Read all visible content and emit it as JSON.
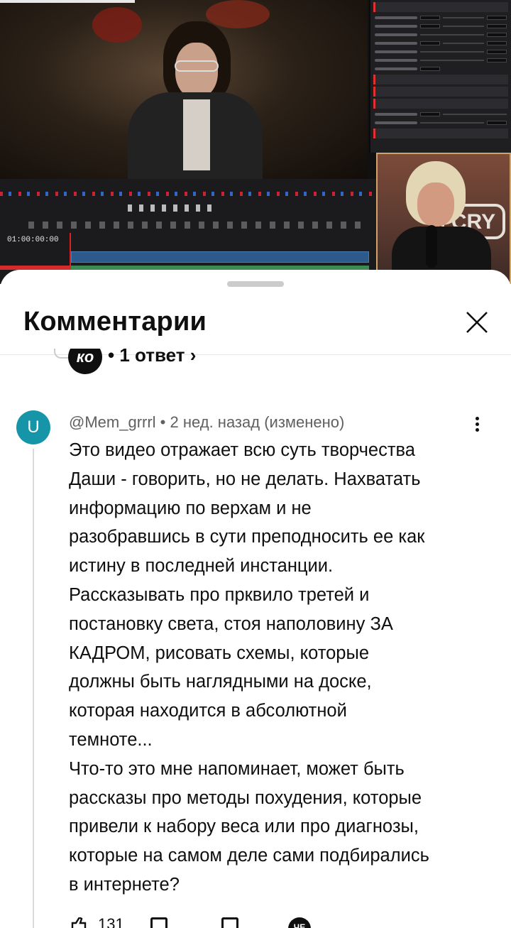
{
  "video": {
    "timecode": "01:00:00:00",
    "webcam_sign": "CRY"
  },
  "sheet": {
    "title": "Комментарии",
    "close_label": "✕"
  },
  "previous_comment": {
    "creator_avatar_text": "ко",
    "replies_text": "• 1 ответ ›"
  },
  "comment": {
    "avatar_letter": "U",
    "avatar_color": "#1695a8",
    "author": "@Mem_grrrl",
    "meta": "@Mem_grrrl • 2 нед. назад (изменено)",
    "lines": [
      "Это видео отражает всю суть творчества",
      "Даши - говорить, но не делать. Нахватать",
      "информацию по верхам и не",
      "разобравшись в сути преподносить ее как",
      "истину в последней инстанции.",
      "Рассказывать про прквило третей и",
      "постановку света, стоя наполовину ЗА",
      "КАДРОМ, рисовать схемы, которые",
      "должны быть наглядными на доске,",
      "которая находится в абсолютной",
      "темноте...",
      "Что-то это мне напоминает, может быть",
      "рассказы про методы похудения, которые",
      "привели к набору веса или про диагнозы,",
      "которые на самом деле сами подбирались",
      "в интернете?"
    ],
    "likes": "131",
    "creator_avatar_text": "ЧЕ"
  },
  "colors": {
    "accent_avatar": "#1695a8",
    "text_primary": "#0f0f0f",
    "text_secondary": "#606060"
  }
}
